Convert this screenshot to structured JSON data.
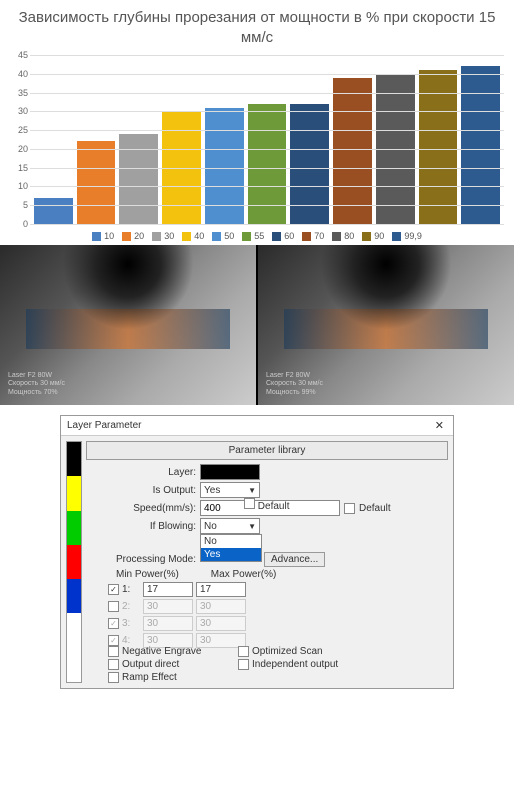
{
  "chart_data": {
    "type": "bar",
    "title": "Зависимость глубины прорезания от мощности в % при скорости 15 мм/с",
    "categories": [
      "10",
      "20",
      "30",
      "40",
      "50",
      "55",
      "60",
      "70",
      "80",
      "90",
      "99,9"
    ],
    "values": [
      7,
      22,
      24,
      30,
      31,
      32,
      32,
      39,
      40,
      41,
      42
    ],
    "colors": [
      "#4a7fc2",
      "#e87d2a",
      "#a0a0a0",
      "#f2c20f",
      "#4f8fcf",
      "#6f9a3a",
      "#294e7a",
      "#9a4f22",
      "#5a5a5a",
      "#8a6f1a",
      "#2d5a8f"
    ],
    "ylabel": "",
    "xlabel": "",
    "ylim": [
      0,
      45
    ],
    "y_ticks": [
      0,
      5,
      10,
      15,
      20,
      25,
      30,
      35,
      40,
      45
    ]
  },
  "photos": {
    "left": {
      "line1": "Laser F2 80W",
      "line2": "Скорость 30 мм/с",
      "line3": "Мощность 70%"
    },
    "right": {
      "line1": "Laser F2 80W",
      "line2": "Скорость 30 мм/с",
      "line3": "Мощность 99%"
    }
  },
  "dialog": {
    "title": "Layer Parameter",
    "param_library_btn": "Parameter library",
    "colors": [
      "#000000",
      "#ffff00",
      "#00cc00",
      "#ff0000",
      "#0033cc",
      "#ffffff",
      "#ffffff"
    ],
    "fields": {
      "layer_label": "Layer:",
      "is_output_label": "Is Output:",
      "is_output_value": "Yes",
      "speed_label": "Speed(mm/s):",
      "speed_value": "400",
      "default_label": "Default",
      "if_blowing_label": "If Blowing:",
      "if_blowing_value": "No",
      "if_blowing_options": [
        "No",
        "Yes"
      ],
      "processing_mode_label": "Processing Mode:",
      "advance_btn": "Advance...",
      "min_power_label": "Min Power(%)",
      "max_power_label": "Max Power(%)",
      "rows": [
        {
          "n": "1:",
          "min": "17",
          "max": "17",
          "enabled": true,
          "checked": true
        },
        {
          "n": "2:",
          "min": "30",
          "max": "30",
          "enabled": false,
          "checked": false
        },
        {
          "n": "3:",
          "min": "30",
          "max": "30",
          "enabled": false,
          "checked": true
        },
        {
          "n": "4:",
          "min": "30",
          "max": "30",
          "enabled": false,
          "checked": true
        }
      ],
      "bottom": {
        "neg_engrave": "Negative Engrave",
        "optimized_scan": "Optimized Scan",
        "output_direct": "Output direct",
        "independent_output": "Independent output",
        "ramp_effect": "Ramp Effect"
      }
    }
  }
}
